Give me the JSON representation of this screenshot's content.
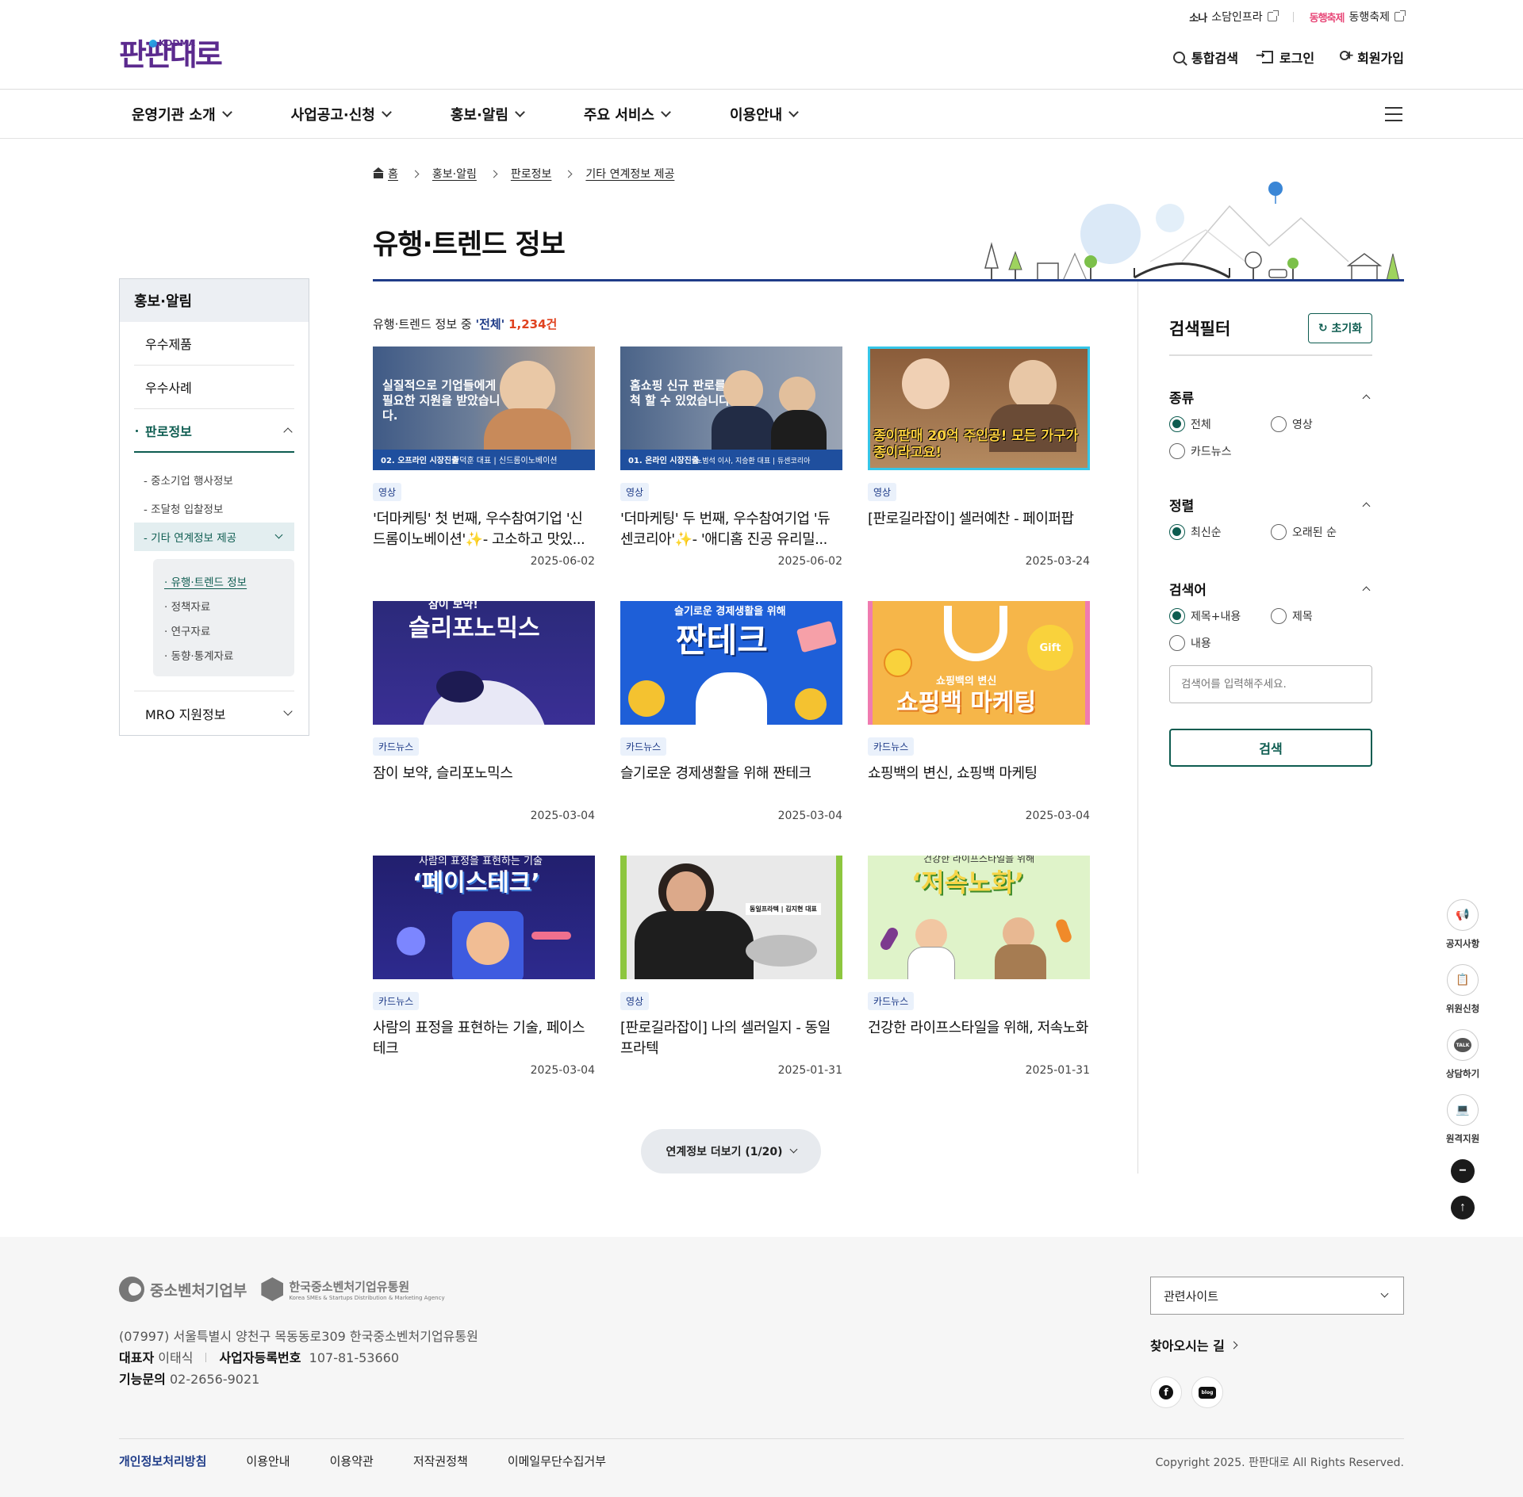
{
  "util": {
    "sodam_mark": "소나",
    "sodam_label": "소담인프라",
    "donghaeng_mark": "동행축제",
    "donghaeng_label": "동행축제"
  },
  "header": {
    "logo_text": "판판대로",
    "logo_sub": "KODMA",
    "links": [
      "통합검색",
      "로그인",
      "회원가입"
    ]
  },
  "gnb": [
    "운영기관 소개",
    "사업공고·신청",
    "홍보·알림",
    "주요 서비스",
    "이용안내"
  ],
  "breadcrumb": [
    "홈",
    "홍보·알림",
    "판로정보",
    "기타 연계정보 제공"
  ],
  "page_title": "유행·트렌드 정보",
  "lnb": {
    "title": "홍보·알림",
    "items": [
      "우수제품",
      "우수사례",
      "판로정보",
      "MRO 지원정보"
    ],
    "sub": [
      "- 중소기업 행사정보",
      "- 조달청 입찰정보",
      "- 기타 연계정보 제공"
    ],
    "sub3": [
      "· 유행·트렌드 정보",
      "· 정책자료",
      "· 연구자료",
      "· 동향·통계자료"
    ]
  },
  "results": {
    "prefix": "유행·트렌드 정보 중 ",
    "filter": "'전체'",
    "count": "1,234건"
  },
  "cards": [
    {
      "type": "영상",
      "title": "'더마케팅' 첫 번째, 우수참여기업 '신드롬이노베이션'✨- 고소하고 맛있...",
      "date": "2025-06-02",
      "thumb_text": "실질적으로 기업들에게 필요한 지원을 받았습니다.",
      "thumb_num": "02. 오프라인 시장진출",
      "thumb_person": "한덕훈 대표 | 신드롬이노베이션"
    },
    {
      "type": "영상",
      "title": "'더마케팅' 두 번째, 우수참여기업 '듀센코리아'✨- '애디홈 진공 유리밀...",
      "date": "2025-06-02",
      "thumb_text": "홈쇼핑 신규 판로를 개척 할 수 있었습니다.",
      "thumb_num": "01. 온라인 시장진출",
      "thumb_person": "노범석 이사, 지승환 대표 | 듀센코리아"
    },
    {
      "type": "영상",
      "title": "[판로길라잡이] 셀러예찬 - 페이퍼팝",
      "date": "2025-03-24",
      "thumb_text": "종이판매 20억 주인공! 모든 가구가 종이라고요!"
    },
    {
      "type": "카드뉴스",
      "title": "잠이 보약, 슬리포노믹스",
      "date": "2025-03-04",
      "thumb_top": "잠이 보약!",
      "thumb_text": "슬리포노믹스"
    },
    {
      "type": "카드뉴스",
      "title": "슬기로운 경제생활을 위해 짠테크",
      "date": "2025-03-04",
      "thumb_top": "슬기로운 경제생활을 위해",
      "thumb_text": "짠테크"
    },
    {
      "type": "카드뉴스",
      "title": "쇼핑백의 변신, 쇼핑백 마케팅",
      "date": "2025-03-04",
      "thumb_top": "쇼핑백의 변신",
      "thumb_text": "쇼핑백 마케팅"
    },
    {
      "type": "카드뉴스",
      "title": "사람의 표정을 표현하는 기술, 페이스테크",
      "date": "2025-03-04",
      "thumb_top": "사람의 표정을 표현하는 기술",
      "thumb_text": "‘페이스테크’"
    },
    {
      "type": "영상",
      "title": "[판로길라잡이] 나의 셀러일지 - 동일프라텍",
      "date": "2025-01-31",
      "thumb_text": "동일프라텍 | 김지현 대표"
    },
    {
      "type": "카드뉴스",
      "title": "건강한 라이프스타일을 위해, 저속노화",
      "date": "2025-01-31",
      "thumb_top": "건강한 라이프스타일을 위해",
      "thumb_text": "‘저속노화’"
    }
  ],
  "more_button": "연계정보 더보기 (1/20)",
  "filter": {
    "title": "검색필터",
    "reset": "초기화",
    "sections": [
      {
        "title": "종류",
        "options": [
          "전체",
          "영상",
          "카드뉴스"
        ],
        "selected": 0
      },
      {
        "title": "정렬",
        "options": [
          "최신순",
          "오래된 순"
        ],
        "selected": 0
      },
      {
        "title": "검색어",
        "options": [
          "제목+내용",
          "제목",
          "내용"
        ],
        "selected": 0
      }
    ],
    "placeholder": "검색어를 입력해주세요.",
    "search_button": "검색"
  },
  "quick": [
    "공지사항",
    "위원신청",
    "상담하기",
    "원격지원"
  ],
  "quick_talk": "TALK",
  "footer": {
    "logo1": "중소벤처기업부",
    "logo2": "한국중소벤처기업유통원",
    "logo2_en": "Korea SMEs & Startups Distribution & Marketing Agency",
    "address": "(07997) 서울특별시 양천구 목동동로309 한국중소벤처기업유통원",
    "ceo_label": "대표자",
    "ceo": "이태식",
    "biz_label": "사업자등록번호",
    "biz": "107-81-53660",
    "tel_label": "기능문의",
    "tel": "02-2656-9021",
    "related": "관련사이트",
    "directions": "찾아오시는 길",
    "blog": "blog",
    "links": [
      "개인정보처리방침",
      "이용안내",
      "이용약관",
      "저작권정책",
      "이메일무단수집거부"
    ],
    "copyright": "Copyright 2025. 판판대로 All Rights Reserved."
  },
  "colors": {
    "primary": "#0d5c50",
    "navy": "#1f3c88",
    "accent_red": "#e0421f"
  }
}
